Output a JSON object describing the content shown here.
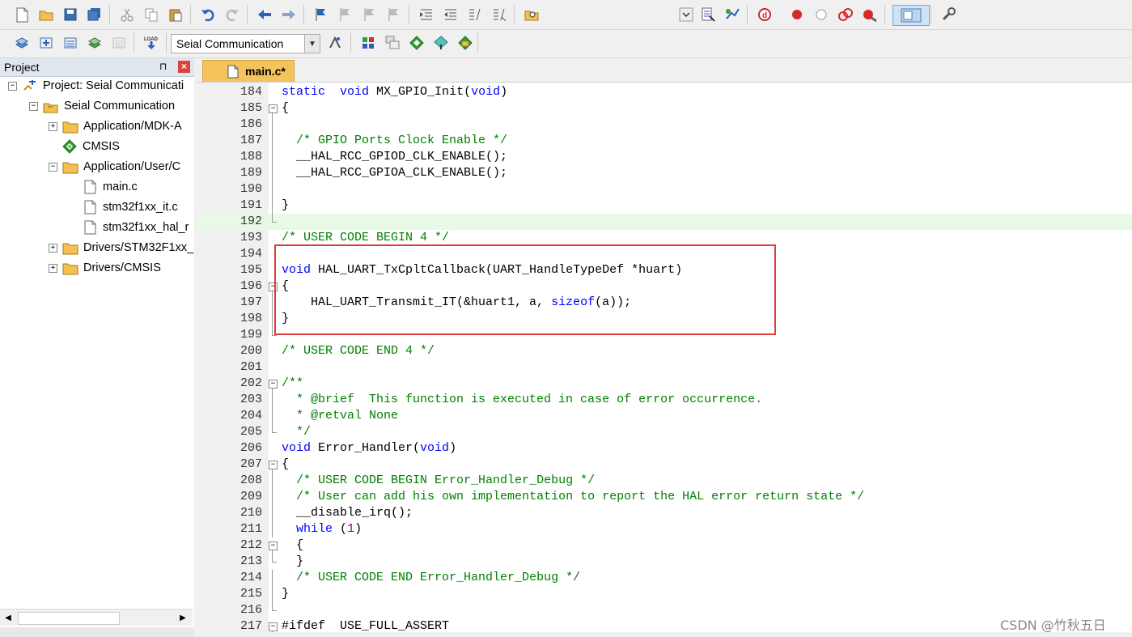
{
  "toolbar1": {
    "icons": [
      "new-file-icon",
      "open-folder-icon",
      "save-icon",
      "save-all-icon",
      "cut-icon",
      "copy-icon",
      "paste-icon",
      "undo-icon",
      "redo-icon",
      "nav-back-icon",
      "nav-forward-icon",
      "bookmark-icon",
      "bookmark-prev-icon",
      "bookmark-next-icon",
      "bookmark-clear-icon",
      "indent-icon",
      "unindent-icon",
      "comment-icon",
      "uncomment-icon",
      "find-in-files-icon",
      "dropdown-icon",
      "debug-settings-icon",
      "insight-icon",
      "start-debug-icon",
      "breakpoint-insert-icon",
      "breakpoint-disable-icon",
      "breakpoint-kill-icon",
      "breakpoint-clear-icon",
      "window-layout-icon",
      "configure-icon"
    ]
  },
  "toolbar2": {
    "icons": [
      "translate-icon",
      "build-icon",
      "rebuild-icon",
      "batch-build-icon",
      "stop-build-icon",
      "download-icon",
      "options-icon",
      "manage-components-icon",
      "file-extensions-icon",
      "run-time-env-icon",
      "pack-installer-icon",
      "select-packs-icon"
    ],
    "load_label": "LOAD",
    "target_value": "Seial Communication"
  },
  "project_panel": {
    "title": "Project",
    "pin": "⊓",
    "close": "×",
    "tree": [
      {
        "label": "Project: Seial Communicati",
        "icon": "project-icon",
        "expand": "−"
      },
      {
        "label": "Seial Communication",
        "icon": "target-folder-icon",
        "expand": "−"
      },
      {
        "label": "Application/MDK-A",
        "icon": "folder-icon",
        "expand": "+"
      },
      {
        "label": "CMSIS",
        "icon": "cmsis-diamond-icon",
        "expand": ""
      },
      {
        "label": "Application/User/C",
        "icon": "folder-icon",
        "expand": "−"
      },
      {
        "label": "main.c",
        "icon": "file-icon",
        "expand": ""
      },
      {
        "label": "stm32f1xx_it.c",
        "icon": "file-icon",
        "expand": ""
      },
      {
        "label": "stm32f1xx_hal_r",
        "icon": "file-icon",
        "expand": ""
      },
      {
        "label": "Drivers/STM32F1xx_",
        "icon": "folder-icon",
        "expand": "+"
      },
      {
        "label": "Drivers/CMSIS",
        "icon": "folder-icon",
        "expand": "+"
      }
    ],
    "scroll_left": "◀",
    "scroll_right": "▶"
  },
  "editor": {
    "tab_label": "main.c*",
    "lines": [
      {
        "n": "184",
        "fold": "",
        "code": [
          [
            "kw",
            "static"
          ],
          [
            "",
            "  "
          ],
          [
            "kw",
            "void"
          ],
          [
            "",
            " MX_GPIO_Init("
          ],
          [
            "kw",
            "void"
          ],
          [
            "",
            ")"
          ]
        ]
      },
      {
        "n": "185",
        "fold": "box-",
        "code": [
          [
            "",
            "{"
          ]
        ]
      },
      {
        "n": "186",
        "fold": "line",
        "code": []
      },
      {
        "n": "187",
        "fold": "line",
        "code": [
          [
            "",
            "  "
          ],
          [
            "cm",
            "/* GPIO Ports Clock Enable */"
          ]
        ]
      },
      {
        "n": "188",
        "fold": "line",
        "code": [
          [
            "",
            "  __HAL_RCC_GPIOD_CLK_ENABLE();"
          ]
        ]
      },
      {
        "n": "189",
        "fold": "line",
        "code": [
          [
            "",
            "  __HAL_RCC_GPIOA_CLK_ENABLE();"
          ]
        ]
      },
      {
        "n": "190",
        "fold": "line",
        "code": []
      },
      {
        "n": "191",
        "fold": "line",
        "code": [
          [
            "",
            "}"
          ]
        ]
      },
      {
        "n": "192",
        "fold": "end",
        "code": [],
        "hl": true
      },
      {
        "n": "193",
        "fold": "",
        "code": [
          [
            "cm",
            "/* USER CODE BEGIN 4 */"
          ]
        ]
      },
      {
        "n": "194",
        "fold": "",
        "code": []
      },
      {
        "n": "195",
        "fold": "",
        "code": [
          [
            "kw",
            "void"
          ],
          [
            "",
            " HAL_UART_TxCpltCallback(UART_HandleTypeDef *huart)"
          ]
        ]
      },
      {
        "n": "196",
        "fold": "box-",
        "code": [
          [
            "",
            "{"
          ]
        ]
      },
      {
        "n": "197",
        "fold": "line",
        "code": [
          [
            "",
            "    HAL_UART_Transmit_IT(&huart1, a, "
          ],
          [
            "kw",
            "sizeof"
          ],
          [
            "",
            "(a));"
          ]
        ]
      },
      {
        "n": "198",
        "fold": "line",
        "code": [
          [
            "",
            "}"
          ]
        ]
      },
      {
        "n": "199",
        "fold": "end",
        "code": []
      },
      {
        "n": "200",
        "fold": "",
        "code": [
          [
            "cm",
            "/* USER CODE END 4 */"
          ]
        ]
      },
      {
        "n": "201",
        "fold": "",
        "code": []
      },
      {
        "n": "202",
        "fold": "box-",
        "code": [
          [
            "cm",
            "/**"
          ]
        ]
      },
      {
        "n": "203",
        "fold": "line",
        "code": [
          [
            "cm",
            "  * @brief  This function is executed in case of error occurrence."
          ]
        ]
      },
      {
        "n": "204",
        "fold": "line",
        "code": [
          [
            "cm",
            "  * @retval None"
          ]
        ]
      },
      {
        "n": "205",
        "fold": "end",
        "code": [
          [
            "cm",
            "  */"
          ]
        ]
      },
      {
        "n": "206",
        "fold": "",
        "code": [
          [
            "kw",
            "void"
          ],
          [
            "",
            " Error_Handler("
          ],
          [
            "kw",
            "void"
          ],
          [
            "",
            ")"
          ]
        ]
      },
      {
        "n": "207",
        "fold": "box-",
        "code": [
          [
            "",
            "{"
          ]
        ]
      },
      {
        "n": "208",
        "fold": "line",
        "code": [
          [
            "",
            "  "
          ],
          [
            "cm",
            "/* USER CODE BEGIN Error_Handler_Debug */"
          ]
        ]
      },
      {
        "n": "209",
        "fold": "line",
        "code": [
          [
            "",
            "  "
          ],
          [
            "cm",
            "/* User can add his own implementation to report the HAL error return state */"
          ]
        ]
      },
      {
        "n": "210",
        "fold": "line",
        "code": [
          [
            "",
            "  __disable_irq();"
          ]
        ]
      },
      {
        "n": "211",
        "fold": "line",
        "code": [
          [
            "",
            "  "
          ],
          [
            "kw",
            "while"
          ],
          [
            "",
            " ("
          ],
          [
            "nm",
            "1"
          ],
          [
            "",
            ")"
          ]
        ]
      },
      {
        "n": "212",
        "fold": "box-",
        "code": [
          [
            "",
            "  {"
          ]
        ]
      },
      {
        "n": "213",
        "fold": "end",
        "code": [
          [
            "",
            "  }"
          ]
        ]
      },
      {
        "n": "214",
        "fold": "line",
        "code": [
          [
            "",
            "  "
          ],
          [
            "cm",
            "/* USER CODE END Error_Handler_Debug */"
          ]
        ]
      },
      {
        "n": "215",
        "fold": "line",
        "code": [
          [
            "",
            "}"
          ]
        ]
      },
      {
        "n": "216",
        "fold": "end",
        "code": []
      },
      {
        "n": "217",
        "fold": "box-",
        "code": [
          [
            "",
            "#ifdef  USE_FULL_ASSERT"
          ]
        ]
      }
    ]
  },
  "watermark": "CSDN @竹秋五日",
  "colors": {
    "keyword": "#0000ff",
    "comment": "#008000",
    "number": "#8b008b",
    "highlight_box": "#e03c3c",
    "tab": "#f5c35c",
    "current_line": "#e6fae6"
  }
}
